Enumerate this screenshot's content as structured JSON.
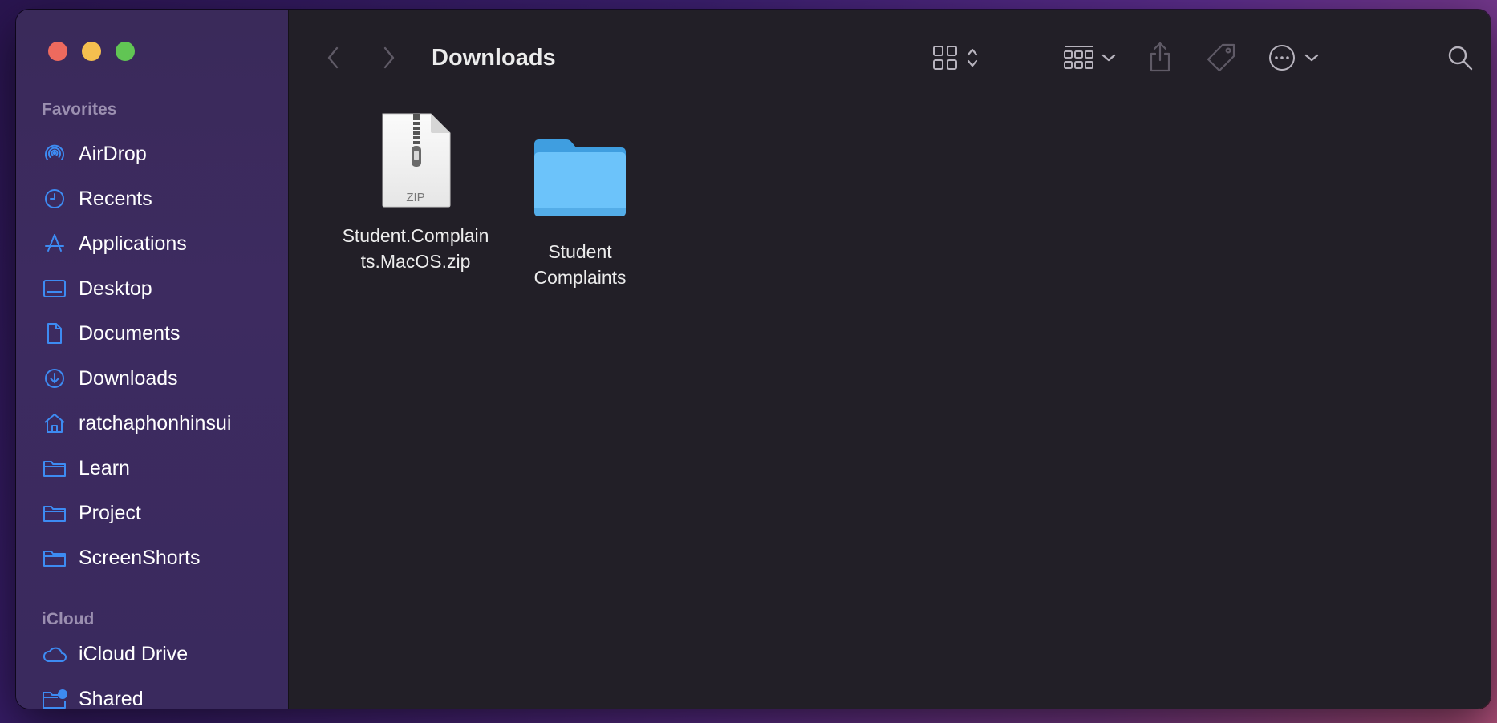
{
  "window": {
    "title": "Downloads",
    "traffic_lights": {
      "close": "#ed6a5e",
      "minimize": "#f5bf4f",
      "zoom": "#61c554"
    }
  },
  "sidebar": {
    "favorites_title": "Favorites",
    "favorites": [
      {
        "label": "AirDrop",
        "icon": "airdrop-icon"
      },
      {
        "label": "Recents",
        "icon": "clock-icon"
      },
      {
        "label": "Applications",
        "icon": "applications-icon"
      },
      {
        "label": "Desktop",
        "icon": "desktop-icon"
      },
      {
        "label": "Documents",
        "icon": "document-icon"
      },
      {
        "label": "Downloads",
        "icon": "download-icon"
      },
      {
        "label": "ratchaphonhinsui",
        "icon": "home-icon"
      },
      {
        "label": "Learn",
        "icon": "folder-icon"
      },
      {
        "label": "Project",
        "icon": "folder-icon"
      },
      {
        "label": "ScreenShorts",
        "icon": "folder-icon"
      }
    ],
    "icloud_title": "iCloud",
    "icloud": [
      {
        "label": "iCloud Drive",
        "icon": "cloud-icon"
      },
      {
        "label": "Shared",
        "icon": "shared-folder-icon"
      }
    ],
    "accent_color": "#3d8bf2"
  },
  "toolbar": {
    "back": "chevron-left-icon",
    "forward": "chevron-right-icon",
    "view_mode": "icon-grid-icon",
    "group_by": "group-grid-icon",
    "share": "share-icon",
    "tags": "tag-icon",
    "more": "ellipsis-circle-icon",
    "search": "search-icon"
  },
  "files": [
    {
      "name": "Student.Complaints.MacOS.zip",
      "name_line1": "Student.Complain",
      "name_line2": "ts.MacOS.zip",
      "kind": "zip",
      "badge": "ZIP"
    },
    {
      "name": "Student Complaints",
      "name_line1": "Student",
      "name_line2": "Complaints",
      "kind": "folder"
    }
  ]
}
